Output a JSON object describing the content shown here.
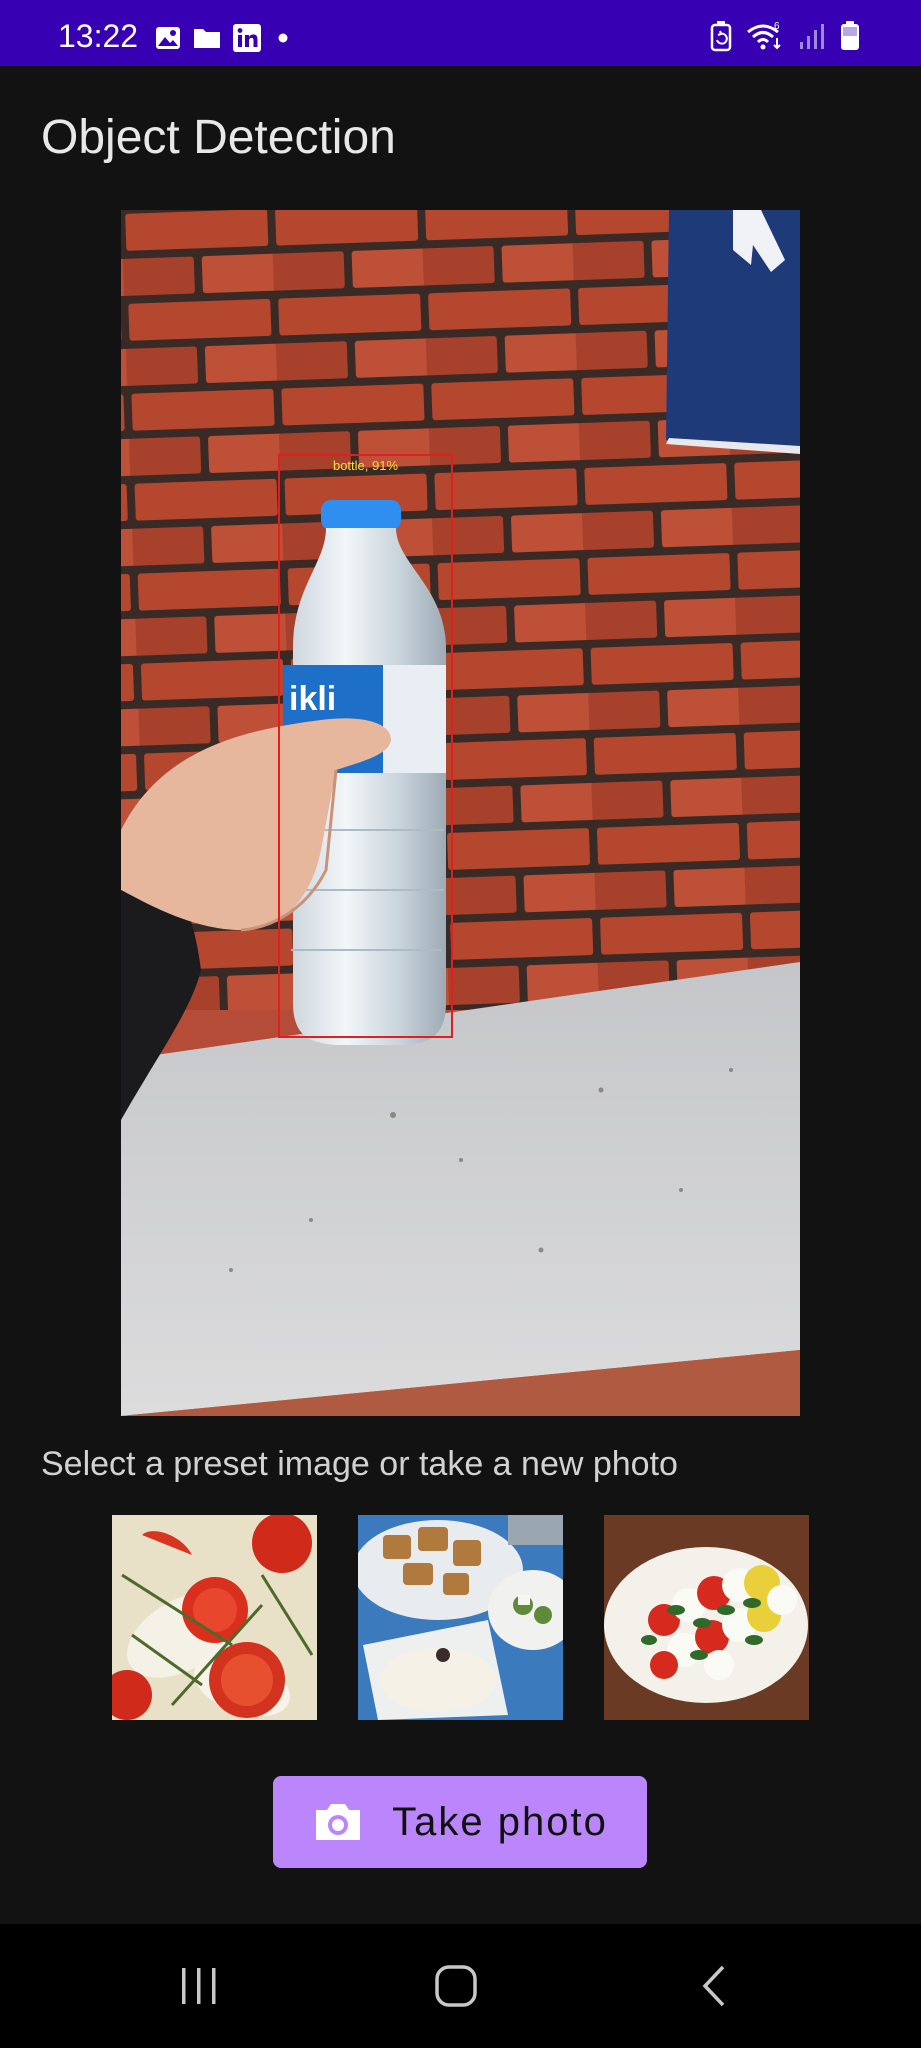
{
  "status_bar": {
    "time": "13:22",
    "left_icons": [
      "gallery-icon",
      "folder-icon",
      "linkedin-icon",
      "dot-icon"
    ],
    "right_icons": [
      "battery-saver-icon",
      "wifi-6-icon",
      "signal-icon",
      "battery-icon"
    ]
  },
  "app": {
    "title": "Object Detection"
  },
  "detection": {
    "label": "bottle, 91%",
    "box_color": "#e02020",
    "label_color": "#f7e03b"
  },
  "preset_prompt": "Select a preset image or take a new photo",
  "presets": [
    {
      "name": "tomatoes-and-onion"
    },
    {
      "name": "mezze-plates"
    },
    {
      "name": "caprese-salad"
    }
  ],
  "take_photo": {
    "label": "Take photo",
    "icon": "camera-icon"
  },
  "nav": {
    "buttons": [
      "recent-apps",
      "home",
      "back"
    ]
  },
  "colors": {
    "status_bar": "#3700b3",
    "accent": "#bb86fc",
    "background": "#121212"
  }
}
